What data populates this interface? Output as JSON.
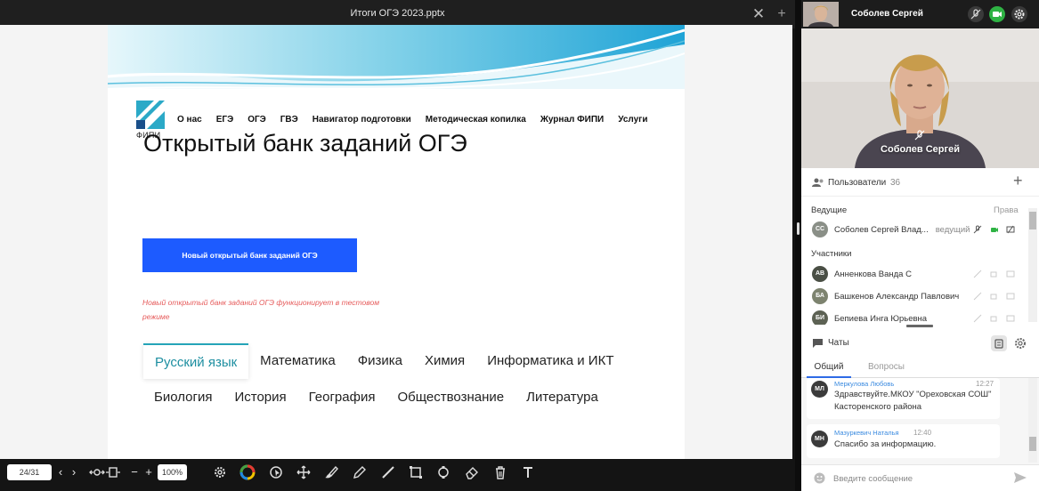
{
  "presentation": {
    "filename": "Итоги ОГЭ 2023.pptx"
  },
  "slide": {
    "logo_text": "ФИПИ",
    "nav": [
      "О нас",
      "ЕГЭ",
      "ОГЭ",
      "ГВЭ",
      "Навигатор подготовки",
      "Методическая копилка",
      "Журнал ФИПИ",
      "Услуги"
    ],
    "title": "Открытый банк заданий ОГЭ",
    "button_label": "Новый открытый банк заданий ОГЭ",
    "note": "Новый открытый банк заданий ОГЭ функционирует в тестовом режиме",
    "subjects_row1": [
      "Русский язык",
      "Математика",
      "Физика",
      "Химия",
      "Информатика и ИКТ"
    ],
    "subjects_row2": [
      "Биология",
      "История",
      "География",
      "Обществознание",
      "Литература"
    ],
    "active_subject": "Русский язык"
  },
  "toolbar": {
    "page_indicator": "24/31",
    "zoom": "100%"
  },
  "presenter": {
    "name": "Соболев Сергей",
    "video_label": "Соболев Сергей"
  },
  "users": {
    "title": "Пользователи",
    "count": "36",
    "hosts_label": "Ведущие",
    "rights_label": "Права",
    "participants_label": "Участники",
    "hosts": [
      {
        "initials": "СС",
        "name": "Соболев Сергей Влад...",
        "role": "ведущий",
        "color": "#8a8f87"
      }
    ],
    "participants": [
      {
        "initials": "АВ",
        "name": "Анненкова Ванда С",
        "color": "#4a4f45"
      },
      {
        "initials": "БА",
        "name": "Башкенов Александр Павлович",
        "color": "#7d836f"
      },
      {
        "initials": "БИ",
        "name": "Бепиева Инга Юрьевна",
        "color": "#5d6254"
      }
    ]
  },
  "chat": {
    "title": "Чаты",
    "tab_general": "Общий",
    "tab_questions": "Вопросы",
    "messages": [
      {
        "initials": "МЛ",
        "author": "Меркулова Любовь",
        "time": "12:27",
        "text": "Здравствуйте.МКОУ \"Ореховская СОШ\" Касторенского района"
      },
      {
        "initials": "МН",
        "author": "Мазуркевич Наталья",
        "time": "12:40",
        "text": "Спасибо за информацию."
      }
    ],
    "input_placeholder": "Введите сообщение"
  },
  "colors": {
    "accent_blue": "#1d5bff",
    "note_red": "#e65b5b",
    "tab_teal": "#25a4b8",
    "camera_green": "#2fb344"
  }
}
